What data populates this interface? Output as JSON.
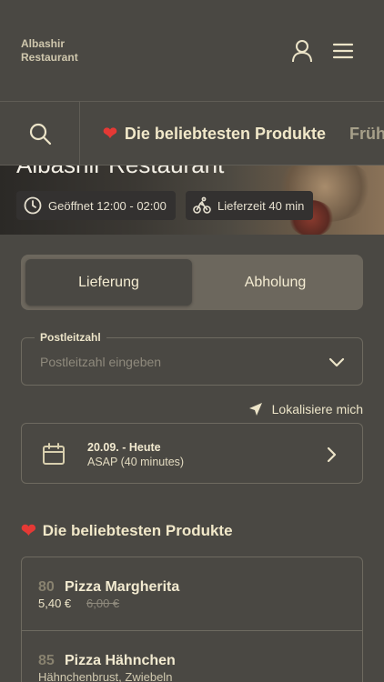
{
  "header": {
    "brand_line1": "Albashir",
    "brand_line2": "Restaurant"
  },
  "category_bar": {
    "active": "Die beliebtesten Produkte",
    "next": "Früh"
  },
  "hero": {
    "title": "Albashir Restaurant",
    "opening": "Geöffnet 12:00 - 02:00",
    "delivery_time": "Lieferzeit 40 min"
  },
  "order_type": {
    "delivery": "Lieferung",
    "pickup": "Abholung",
    "selected": "Lieferung"
  },
  "zip": {
    "label": "Postleitzahl",
    "placeholder": "Postleitzahl eingeben"
  },
  "locate_label": "Lokalisiere mich",
  "schedule": {
    "date": "20.09. - Heute",
    "time": "ASAP (40 minutes)"
  },
  "popular": {
    "title": "Die beliebtesten Produkte",
    "items": [
      {
        "number": "80",
        "name": "Pizza Margherita",
        "price": "5,40 €",
        "old_price": "6,00 €"
      },
      {
        "number": "85",
        "name": "Pizza Hähnchen",
        "description": "Hähnchenbrust, Zwiebeln"
      }
    ]
  },
  "colors": {
    "background": "#4a4843",
    "accent_text": "#f1e8c9",
    "heart": "#e53935",
    "toggle_track": "#6c675d"
  },
  "icons": {
    "user": "user-icon",
    "menu": "menu-icon",
    "search": "search-icon",
    "clock": "clock-icon",
    "bike": "bike-icon",
    "chevron_down": "chevron-down-icon",
    "location": "location-arrow-icon",
    "calendar": "calendar-icon",
    "chevron_right": "chevron-right-icon",
    "heart": "heart-icon"
  }
}
